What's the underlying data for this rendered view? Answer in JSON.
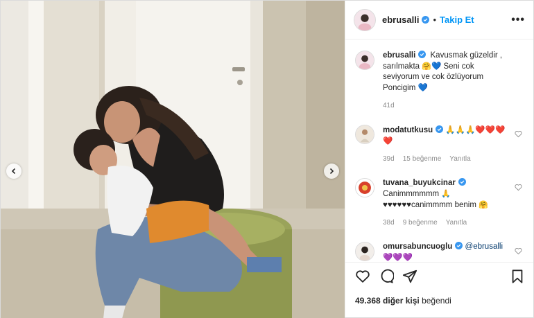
{
  "post": {
    "username": "ebrusalli",
    "follow_label": "Takip Et",
    "more_label": "•••",
    "separator": "•"
  },
  "caption": {
    "username": "ebrusalli",
    "text_part1": "Kavusmak güzeldir , sarılmakta",
    "text_part2": "Seni cok seviyorum ve cok özlüyorum Poncigim",
    "time": "41d"
  },
  "comments": [
    {
      "username": "modatutkusu",
      "text": "🙏🙏🙏❤️❤️❤️❤️",
      "time": "39d",
      "likes": "15 beğenme",
      "reply": "Yanıtla"
    },
    {
      "username": "tuvana_buyukcinar",
      "text_line1": "Canimmmmmm",
      "text_line2_prefix": "♥♥♥♥♥♥",
      "text_line2": "canimmmm benim",
      "time": "38d",
      "likes": "9 beğenme",
      "reply": "Yanıtla"
    },
    {
      "username": "omursabuncuoglu",
      "mention": "@ebrusalli",
      "text": "💜💜💜"
    }
  ],
  "likes": {
    "count": "49.368",
    "suffix": "diğer kişi",
    "verb": "beğendi"
  },
  "icons": {
    "like": "heart-icon",
    "comment": "comment-icon",
    "share": "share-icon",
    "save": "bookmark-icon",
    "prev": "chevron-left-icon",
    "next": "chevron-right-icon",
    "verified": "verified-badge-icon"
  },
  "colors": {
    "accent": "#0095f6",
    "verified": "#3897f0",
    "muted": "#8e8e8e",
    "text": "#262626"
  }
}
